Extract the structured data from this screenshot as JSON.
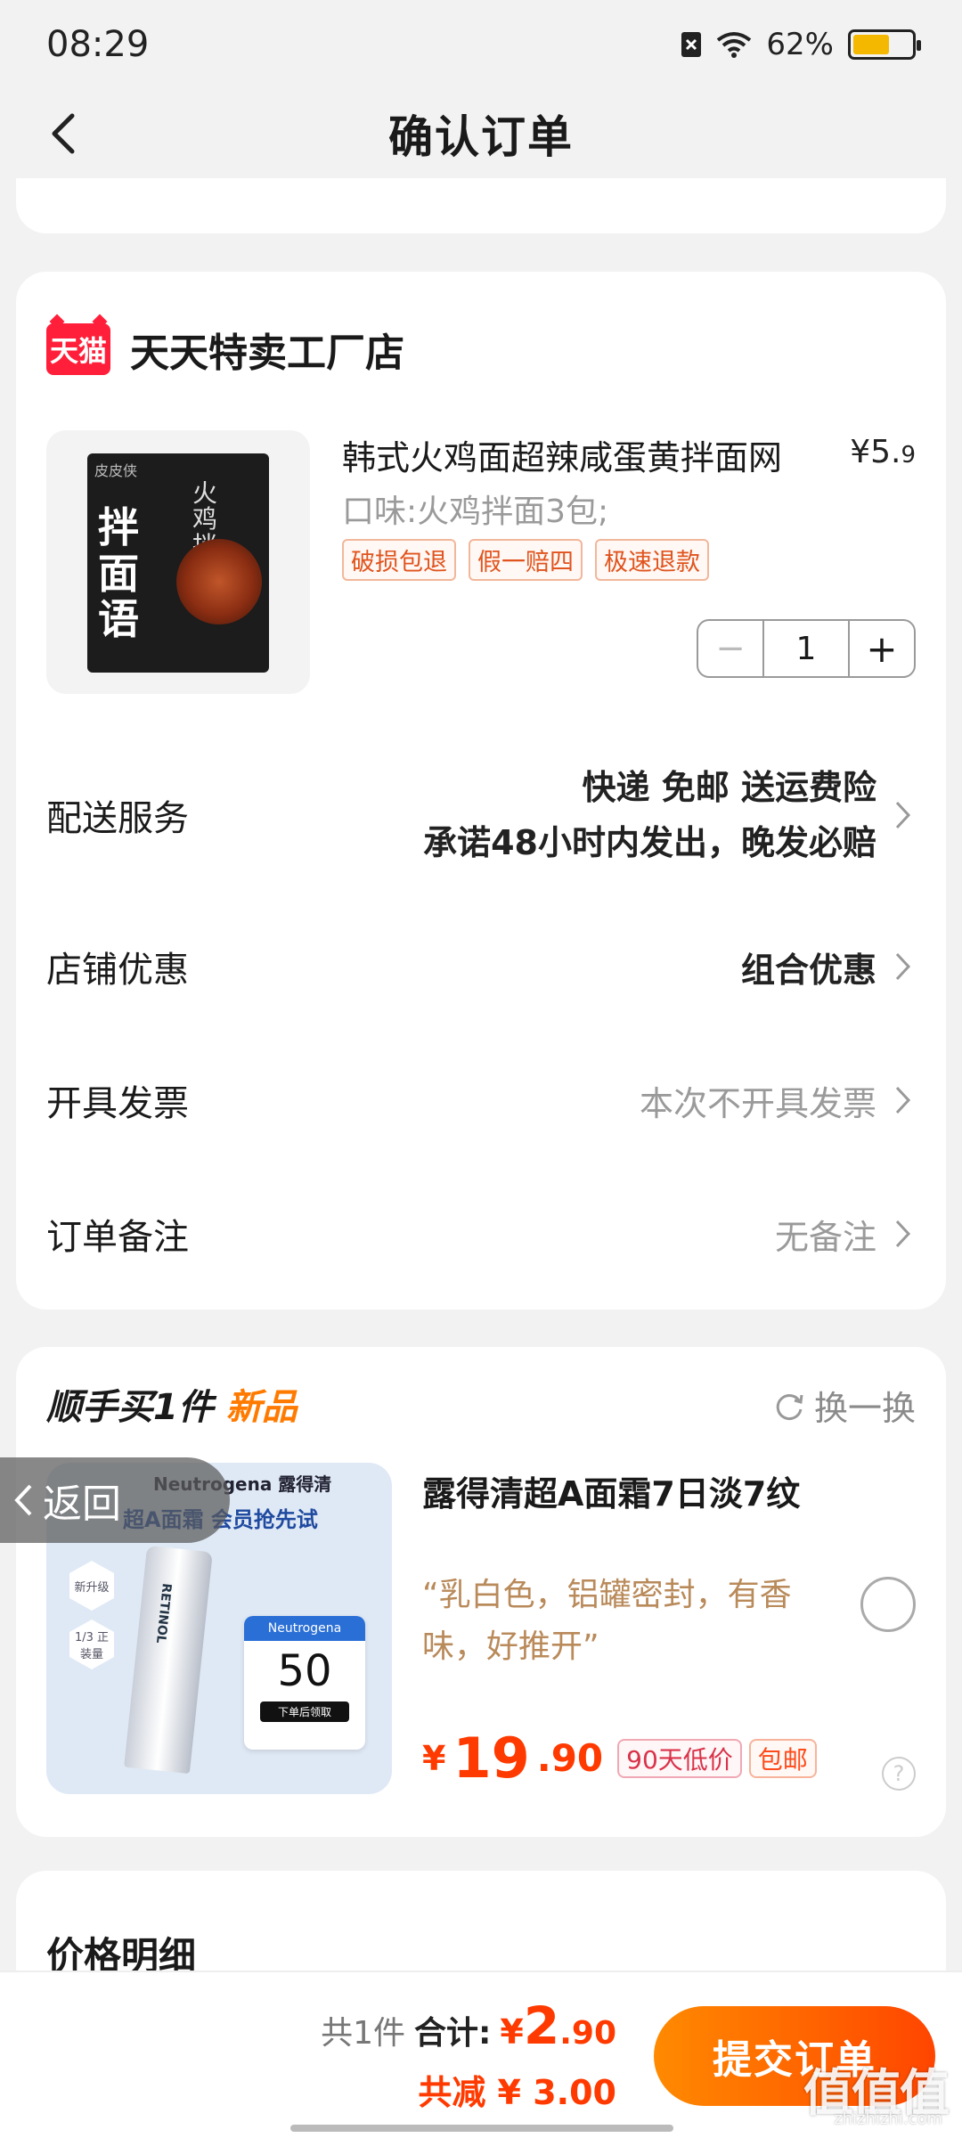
{
  "status": {
    "time": "08:29",
    "battery": "62%",
    "battery_level": 0.62
  },
  "header": {
    "title": "确认订单"
  },
  "shop": {
    "badge": "天猫",
    "name": "天天特卖工厂店",
    "product": {
      "title": "韩式火鸡面超辣咸蛋黄拌面网",
      "price_symbol": "¥",
      "price_int": "5.",
      "price_dec": "9",
      "spec": "口味:火鸡拌面3包;",
      "tags": [
        "破损包退",
        "假一赔四",
        "极速退款"
      ],
      "quantity": "1",
      "package": {
        "brand": "皮皮侠",
        "big_text": "拌面语",
        "small_text": "火鸡拌面"
      }
    },
    "rows": {
      "delivery": {
        "label": "配送服务",
        "line1": "快递 免邮 送运费险",
        "line2": "承诺48小时内发出，晚发必赔"
      },
      "discount": {
        "label": "店铺优惠",
        "value": "组合优惠"
      },
      "invoice": {
        "label": "开具发票",
        "value": "本次不开具发票"
      },
      "note": {
        "label": "订单备注",
        "value": "无备注"
      }
    }
  },
  "extra": {
    "head_prefix": "顺手买1件",
    "head_new": "新品",
    "refresh": "换一换",
    "image": {
      "brand": "Neutrogena 露得清",
      "line": "超A面霜 会员抢先试",
      "hex1": "新升级",
      "hex2": "1/3 正装量",
      "tube": "RETINOL",
      "coupon_head": "Neutrogena",
      "coupon_num": "50",
      "coupon_btn": "下单后领取"
    },
    "title": "露得清超A面霜7日淡7纹",
    "quote": "“乳白色，铝罐密封，有香味，好推开”",
    "price_symbol": "¥",
    "price_int": "19",
    "price_dec": ".90",
    "tag1": "90天低价",
    "tag2": "包邮",
    "help": "?"
  },
  "floating_back": "返回",
  "price_section": {
    "title": "价格明细"
  },
  "footer": {
    "count": "共1件",
    "total_label": "合计:",
    "total_symbol": "¥",
    "total_int": "2",
    "total_dec": ".90",
    "saved": "共减 ¥ 3.00",
    "submit": "提交订单"
  },
  "watermark": {
    "main": "值值值",
    "sub": "zhizhizhi.com"
  },
  "colors": {
    "accent": "#ff4500",
    "price_red": "#ff3a00",
    "tmall_red": "#ff1f3a",
    "tag_orange": "#e0541e"
  }
}
